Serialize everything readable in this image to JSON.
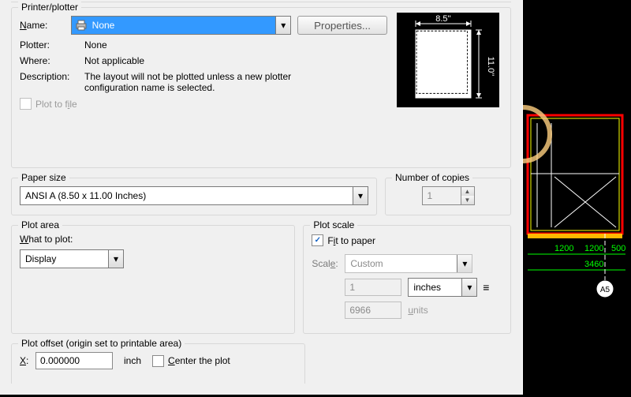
{
  "printer": {
    "legend": "Printer/plotter",
    "name_label": "Name:",
    "name_value": "None",
    "properties_btn": "Properties...",
    "plotter_label": "Plotter:",
    "plotter_value": "None",
    "where_label": "Where:",
    "where_value": "Not applicable",
    "desc_label": "Description:",
    "desc_value": "The layout will not be plotted unless a new plotter configuration name is selected.",
    "plot_to_file": "Plot to file",
    "preview_w": "8.5''",
    "preview_h": "11.0''"
  },
  "paper": {
    "legend": "Paper size",
    "value": "ANSI A (8.50 x 11.00 Inches)"
  },
  "copies": {
    "legend": "Number of copies",
    "value": "1"
  },
  "area": {
    "legend": "Plot area",
    "what_label": "What to plot:",
    "value": "Display"
  },
  "scale": {
    "legend": "Plot scale",
    "fit": "Fit to paper",
    "scale_label": "Scale:",
    "scale_value": "Custom",
    "num": "1",
    "unit": "inches",
    "units_num": "6966",
    "units_label": "units"
  },
  "offset": {
    "legend": "Plot offset (origin set to printable area)",
    "x_label": "X:",
    "x_value": "0.000000",
    "x_unit": "inch",
    "center": "Center the plot"
  },
  "cad_dims": {
    "a": "1200",
    "b": "1200",
    "c": "500",
    "d": "3460",
    "bubble": "A5"
  }
}
